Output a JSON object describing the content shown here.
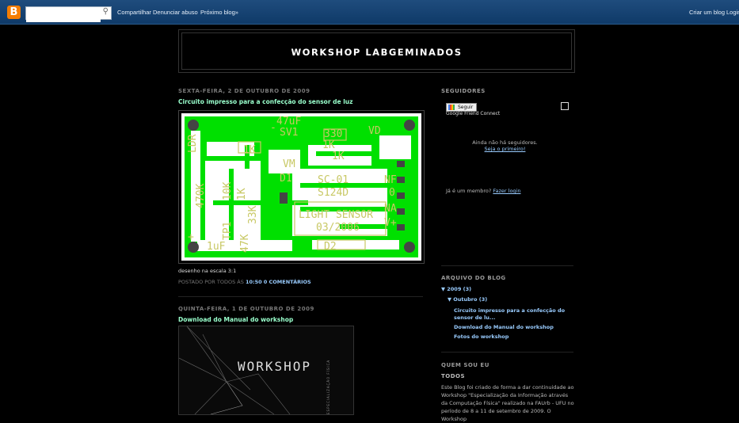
{
  "navbar": {
    "logo": "B",
    "search_placeholder": "",
    "share": "Compartilhar",
    "report": "Denunciar abuso",
    "next_blog": "Próximo blog»",
    "create_blog": "Criar um blog",
    "login": "Login"
  },
  "blog": {
    "title": "WORKSHOP LABGEMINADOS"
  },
  "posts": [
    {
      "date": "SEXTA-FEIRA, 2 DE OUTUBRO DE 2009",
      "title": "Circuito impresso para a confecção do sensor de luz",
      "caption": "desenho na escala 3:1",
      "footer_prefix": "POSTADO POR TODOS ÀS",
      "time": "10:50",
      "comments": "0 COMENTÁRIOS",
      "pcb_labels": {
        "ldr": "LDR",
        "c47u": "47uF",
        "sv1": "SV1",
        "r330": "330",
        "vd": "VD",
        "r1k_a": "1K",
        "r1k_b": "1K",
        "r1k_c": "1K",
        "r470k": "470K",
        "r10k": "10K",
        "r1k_d": "1K",
        "r33k": "33K",
        "r47k": "47K",
        "vm": "VM",
        "d1": "D1",
        "sc01": "SC-01",
        "s124d": "S124D",
        "nf": "NF",
        "o": "0",
        "na": "NA",
        "vp": "V+",
        "light": "LIGHT SENSOR",
        "year": "03/2006",
        "c1u": "1uF",
        "tp1": "TP1",
        "d2": "D2",
        "plus": "+",
        "minus": "-"
      }
    },
    {
      "date": "QUINTA-FEIRA, 1 DE OUTUBRO DE 2009",
      "title": "Download do Manual do workshop",
      "image_text": "WORKSHOP",
      "image_side_text": "ESPECIALIZAÇÃO FÍSICA"
    }
  ],
  "sidebar": {
    "followers": {
      "heading": "SEGUIDORES",
      "follow_button": "Seguir",
      "gfc": "Google Friend Connect",
      "no_followers": "Ainda não há seguidores.",
      "be_first": "Seja o primeiro!",
      "member_prefix": "Já é um membro?",
      "login_link": "Fazer login"
    },
    "archive": {
      "heading": "ARQUIVO DO BLOG",
      "year": "▼ 2009 (3)",
      "month": "▼ Outubro (3)",
      "items": [
        "Circuito impresso para a confecção do sensor de lu...",
        "Download do Manual do workshop",
        "Fotos do workshop"
      ]
    },
    "about": {
      "heading": "QUEM SOU EU",
      "name": "TODOS",
      "text": "Este Blog foi criado de forma a dar continuidade ao Workshop \"Especialização da Informação através da Computação Física\" realizado na FAUrb - UFU no período de 8 a 11 de setembro de 2009. O Workshop"
    }
  },
  "colors": {
    "navbar": "#15426f",
    "background": "#000000",
    "pcb_green": "#00e000",
    "pcb_label": "#c8c864",
    "link": "#99ccff",
    "post_title": "#99ffcc"
  }
}
